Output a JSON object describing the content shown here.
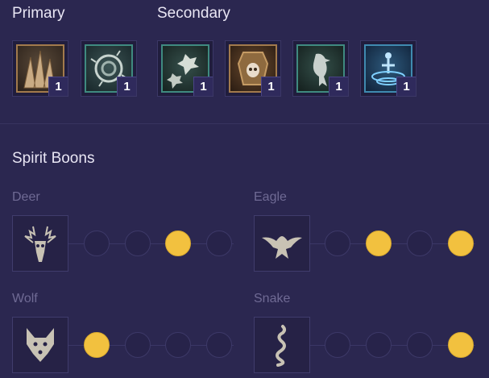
{
  "skills": {
    "primary_label": "Primary",
    "secondary_label": "Secondary",
    "primary": [
      {
        "icon": "spikes-icon",
        "rank": "1",
        "color": "#a27a4c"
      },
      {
        "icon": "thorn-vortex-icon",
        "rank": "1",
        "color": "#3f8a80"
      }
    ],
    "secondary": [
      {
        "icon": "wolf-pack-icon",
        "rank": "1",
        "color": "#3f8a80"
      },
      {
        "icon": "skull-shield-icon",
        "rank": "1",
        "color": "#a27a4c"
      },
      {
        "icon": "raven-icon",
        "rank": "1",
        "color": "#3f8a80"
      },
      {
        "icon": "cyclone-icon",
        "rank": "1",
        "color": "#3f8ab0"
      }
    ]
  },
  "spirit_boons": {
    "title": "Spirit Boons",
    "boons": [
      {
        "name": "Deer",
        "icon": "deer-skull-icon",
        "selected": [
          false,
          false,
          true,
          false
        ]
      },
      {
        "name": "Eagle",
        "icon": "eagle-icon",
        "selected": [
          false,
          true,
          false,
          true
        ]
      },
      {
        "name": "Wolf",
        "icon": "wolf-head-icon",
        "selected": [
          true,
          false,
          false,
          false
        ]
      },
      {
        "name": "Snake",
        "icon": "snake-icon",
        "selected": [
          false,
          false,
          false,
          true
        ]
      }
    ]
  },
  "colors": {
    "accent_selected": "#f2c13f",
    "background": "#2b2750"
  }
}
